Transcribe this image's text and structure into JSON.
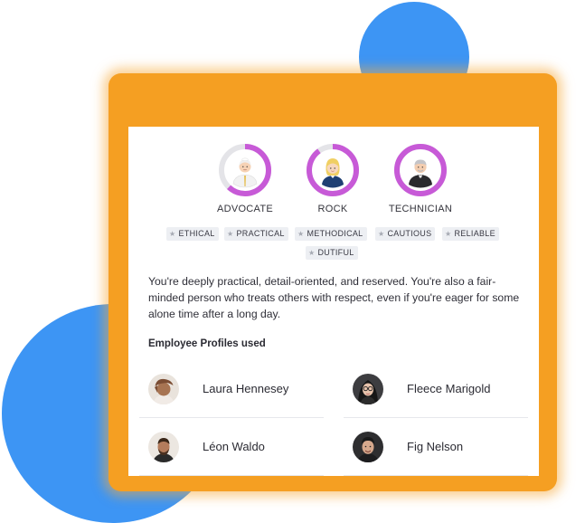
{
  "personas": [
    {
      "label": "ADVOCATE",
      "fill_fraction": 0.62,
      "ring_color": "#c75ad7"
    },
    {
      "label": "ROCK",
      "fill_fraction": 0.9,
      "ring_color": "#c75ad7"
    },
    {
      "label": "TECHNICIAN",
      "fill_fraction": 1.0,
      "ring_color": "#c75ad7"
    }
  ],
  "tags": [
    "ETHICAL",
    "PRACTICAL",
    "METHODICAL",
    "CAUTIOUS",
    "RELIABLE",
    "DUTIFUL"
  ],
  "summary": "You're deeply practical, detail-oriented, and reserved. You're also a fair-minded person who treats others with respect, even if you're eager for some alone time after a long day.",
  "profiles_section": {
    "title": "Employee Profiles used",
    "employees": [
      {
        "name": "Laura Hennesey"
      },
      {
        "name": "Fleece Marigold"
      },
      {
        "name": "Léon Waldo"
      },
      {
        "name": "Fig Nelson"
      }
    ]
  },
  "colors": {
    "frame": "#f59f22",
    "blob": "#3d95f4",
    "ring_track": "#e4e4e8",
    "ring_accent": "#c75ad7",
    "tag_bg": "#edeff3"
  }
}
